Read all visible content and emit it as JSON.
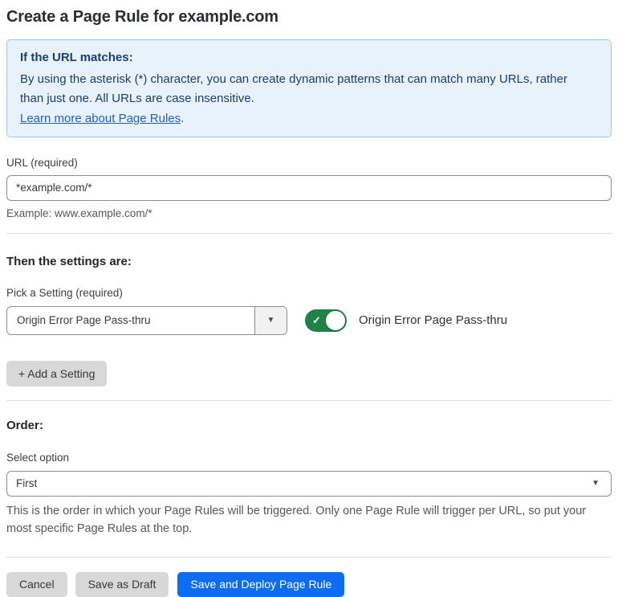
{
  "page": {
    "title": "Create a Page Rule for example.com"
  },
  "info_box": {
    "heading": "If the URL matches:",
    "body": "By using the asterisk (*) character, you can create dynamic patterns that can match many URLs, rather than just one. All URLs are case insensitive.",
    "link_label": "Learn more about Page Rules",
    "link_suffix": "."
  },
  "url_section": {
    "label": "URL (required)",
    "value": "*example.com/*",
    "helper": "Example: www.example.com/*"
  },
  "settings_section": {
    "heading": "Then the settings are:",
    "picker_label": "Pick a Setting (required)",
    "selected_setting": "Origin Error Page Pass-thru",
    "toggle_label": "Origin Error Page Pass-thru",
    "toggle_state": "on",
    "add_button_label": "+ Add a Setting"
  },
  "order_section": {
    "heading": "Order:",
    "select_label": "Select option",
    "selected_option": "First",
    "helper": "This is the order in which your Page Rules will be triggered. Only one Page Rule will trigger per URL, so put your most specific Page Rules at the top."
  },
  "footer": {
    "cancel_label": "Cancel",
    "save_draft_label": "Save as Draft",
    "save_deploy_label": "Save and Deploy Page Rule"
  },
  "icons": {
    "dropdown_arrow": "▼",
    "check": "✓"
  },
  "colors": {
    "accent_blue": "#0c6cf2",
    "info_bg": "#e8f2fb",
    "info_border": "#9ec5ea",
    "info_text": "#1e3c6e",
    "link_blue": "#2160c4",
    "toggle_green": "#218246",
    "button_gray": "#d8d8d8"
  }
}
